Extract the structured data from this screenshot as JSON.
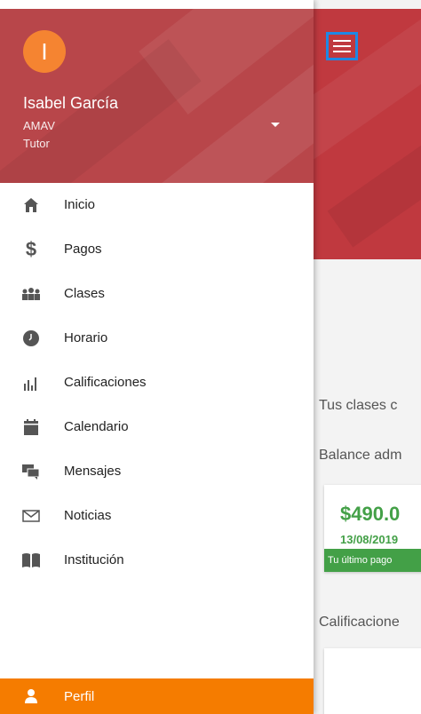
{
  "user": {
    "initial": "I",
    "name": "Isabel García",
    "institution": "AMAV",
    "role": "Tutor"
  },
  "menu": {
    "items": [
      {
        "label": "Inicio",
        "icon": "home-icon"
      },
      {
        "label": "Pagos",
        "icon": "dollar-icon"
      },
      {
        "label": "Clases",
        "icon": "people-icon"
      },
      {
        "label": "Horario",
        "icon": "clock-icon"
      },
      {
        "label": "Calificaciones",
        "icon": "bar-chart-icon"
      },
      {
        "label": "Calendario",
        "icon": "calendar-icon"
      },
      {
        "label": "Mensajes",
        "icon": "chat-icon"
      },
      {
        "label": "Noticias",
        "icon": "envelope-icon"
      },
      {
        "label": "Institución",
        "icon": "book-icon"
      }
    ],
    "active": {
      "label": "Perfil",
      "icon": "person-icon"
    }
  },
  "background": {
    "clases_text": "Tus clases c",
    "balance_text": "Balance adm",
    "amount": "$490.0",
    "date": "13/08/2019",
    "footer": "Tu último pago",
    "calificaciones_text": "Calificacione"
  },
  "colors": {
    "header_red": "#b8464a",
    "avatar_orange": "#f58431",
    "active_orange": "#f57c00",
    "green": "#43a047",
    "focus_blue": "#1e88e5"
  }
}
